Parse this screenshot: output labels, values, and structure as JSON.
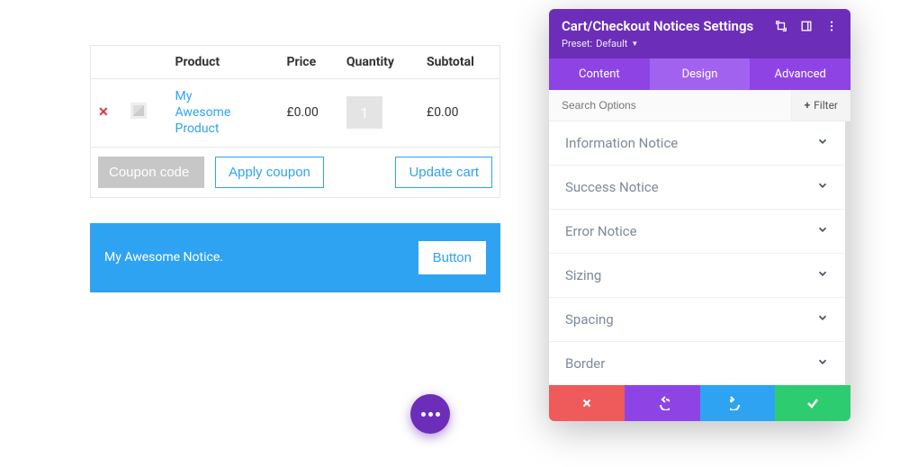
{
  "cart": {
    "headers": {
      "product": "Product",
      "price": "Price",
      "quantity": "Quantity",
      "subtotal": "Subtotal"
    },
    "item": {
      "name": "My Awesome Product",
      "price": "£0.00",
      "quantity": "1",
      "subtotal": "£0.00"
    },
    "coupon_placeholder": "Coupon code",
    "apply_coupon_label": "Apply coupon",
    "update_cart_label": "Update cart"
  },
  "notice": {
    "text": "My Awesome Notice.",
    "button_label": "Button"
  },
  "panel": {
    "title": "Cart/Checkout Notices Settings",
    "preset_label": "Preset:",
    "preset_value": "Default",
    "tabs": {
      "content": "Content",
      "design": "Design",
      "advanced": "Advanced"
    },
    "search_placeholder": "Search Options",
    "filter_label": "Filter",
    "sections": [
      "Information Notice",
      "Success Notice",
      "Error Notice",
      "Sizing",
      "Spacing",
      "Border"
    ]
  }
}
